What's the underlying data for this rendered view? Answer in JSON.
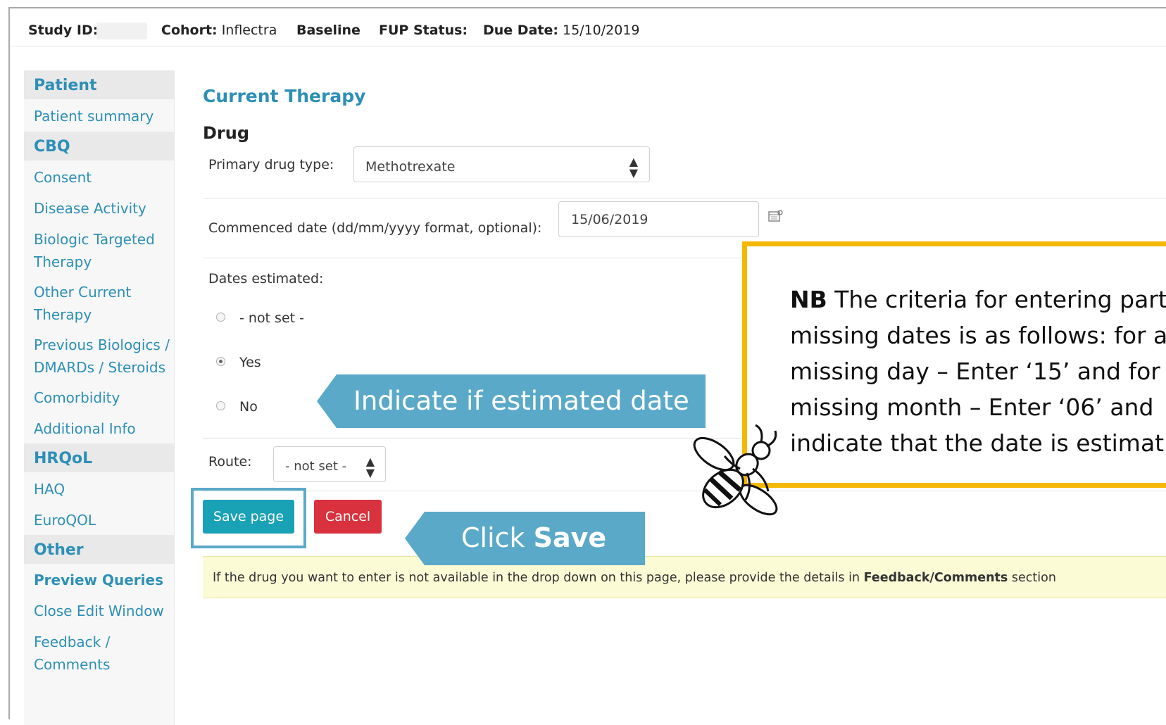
{
  "header": {
    "study_id_label": "Study ID:",
    "cohort_label": "Cohort:",
    "cohort_value": "Inflectra",
    "baseline_label": "Baseline",
    "fup_label": "FUP Status:",
    "due_label": "Due Date:",
    "due_value": "15/10/2019"
  },
  "sidebar": {
    "sections": [
      {
        "title": "Patient",
        "items": [
          "Patient summary"
        ]
      },
      {
        "title": "CBQ",
        "items": [
          "Consent",
          "Disease Activity",
          "Biologic Targeted Therapy",
          "Other Current Therapy",
          "Previous Biologics / DMARDs / Steroids",
          "Comorbidity",
          "Additional Info"
        ]
      },
      {
        "title": "HRQoL",
        "items": [
          "HAQ",
          "EuroQOL"
        ]
      },
      {
        "title": "Other",
        "items": [
          "Preview Queries",
          "Close Edit Window",
          "Feedback / Comments"
        ]
      }
    ],
    "link_lines": {
      "patient_summary": "Patient summary",
      "consent": "Consent",
      "disease_activity": "Disease Activity",
      "biologic_1": "Biologic Targeted",
      "biologic_2": "Therapy",
      "other_current_1": "Other Current",
      "other_current_2": "Therapy",
      "previous_1": "Previous Biologics /",
      "previous_2": "DMARDs / Steroids",
      "comorbidity": "Comorbidity",
      "additional_info": "Additional Info",
      "haq": "HAQ",
      "euroqol": "EuroQOL",
      "preview_queries": "Preview Queries",
      "close_edit": "Close Edit Window",
      "feedback_1": "Feedback /",
      "feedback_2": "Comments"
    }
  },
  "form": {
    "section_title": "Current Therapy",
    "subsection_title": "Drug",
    "primary_drug_label": "Primary drug type:",
    "primary_drug_value": "Methotrexate",
    "commenced_label": "Commenced date (dd/mm/yyyy format, optional):",
    "commenced_value": "15/06/2019",
    "dates_estimated_label": "Dates estimated:",
    "radio_options": [
      "- not set -",
      "Yes",
      "No"
    ],
    "radio_selected": "Yes",
    "route_label": "Route:",
    "route_value": "- not set -",
    "save_label": "Save page",
    "cancel_label": "Cancel",
    "notice_prefix": "If the drug you want to enter is not available in the drop down on this page, please provide the details in ",
    "notice_bold": "Feedback/Comments",
    "notice_suffix": " section"
  },
  "annotations": {
    "estimate_callout": "Indicate if estimated date",
    "save_callout_prefix": "Click ",
    "save_callout_bold": "Save",
    "nb_bold": "NB",
    "nb_lines": [
      " The criteria for entering part",
      "missing dates is as follows: for a",
      "missing day – Enter ‘15’ and for",
      "missing month – Enter ‘06’ and",
      "indicate that the date is estimat"
    ]
  },
  "colors": {
    "link_blue": "#2d8fb6",
    "callout_blue": "#5ba9c8",
    "save_teal": "#19a1b5",
    "cancel_red": "#d9313e",
    "nb_yellow": "#f5b800",
    "notice_bg": "#fbfbd6"
  },
  "icons": [
    "sort-arrows-icon",
    "calendar-icon",
    "bee-icon"
  ]
}
